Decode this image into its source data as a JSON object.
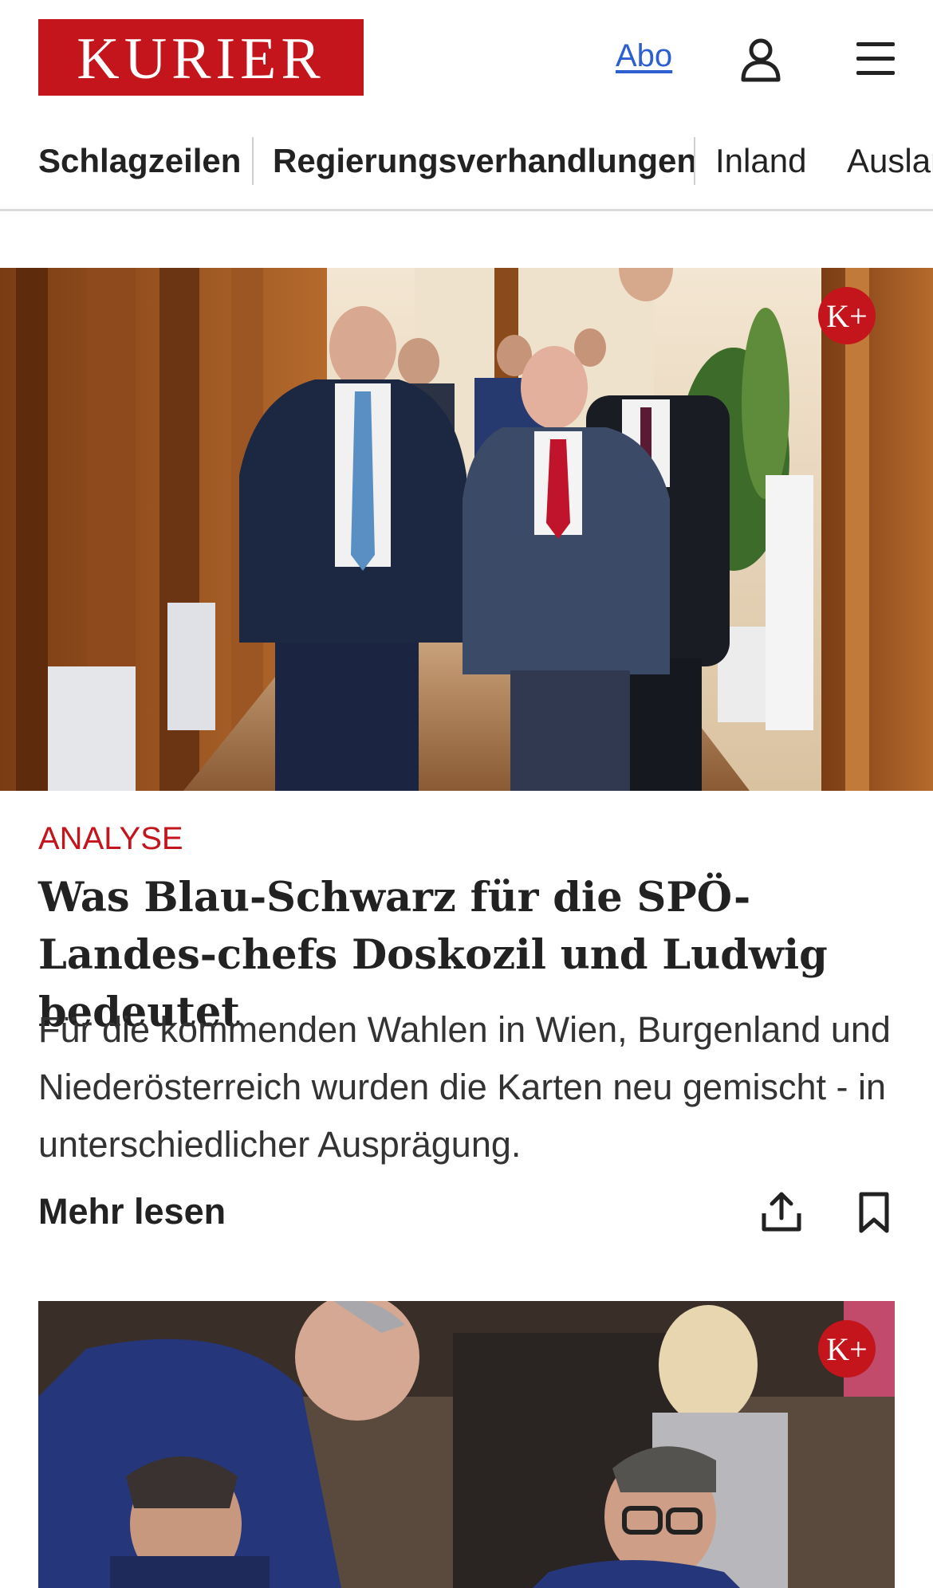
{
  "header": {
    "logo_text": "KURIER",
    "abo_label": "Abo",
    "user_icon": "user-icon",
    "menu_icon": "hamburger-menu-icon"
  },
  "nav": {
    "items": [
      {
        "label": "Schlagzeilen"
      },
      {
        "label": "Regierungsverhandlungen"
      },
      {
        "label": "Inland"
      },
      {
        "label": "Ausland"
      }
    ]
  },
  "articles": [
    {
      "premium_badge": "K+",
      "kicker": "ANALYSE",
      "headline": "Was Blau-Schwarz für die SPÖ-Landes-chefs Doskozil und Ludwig bedeutet",
      "teaser": "Für die kommenden Wahlen in Wien, Burgenland und Niederösterreich wurden die Karten neu gemischt - in unterschiedlicher Ausprägung.",
      "more_label": "Mehr lesen",
      "share_icon": "share-icon",
      "bookmark_icon": "bookmark-icon"
    },
    {
      "premium_badge": "K+"
    }
  ],
  "colors": {
    "brand_red": "#c4141c",
    "link_blue": "#2e5fd1"
  }
}
